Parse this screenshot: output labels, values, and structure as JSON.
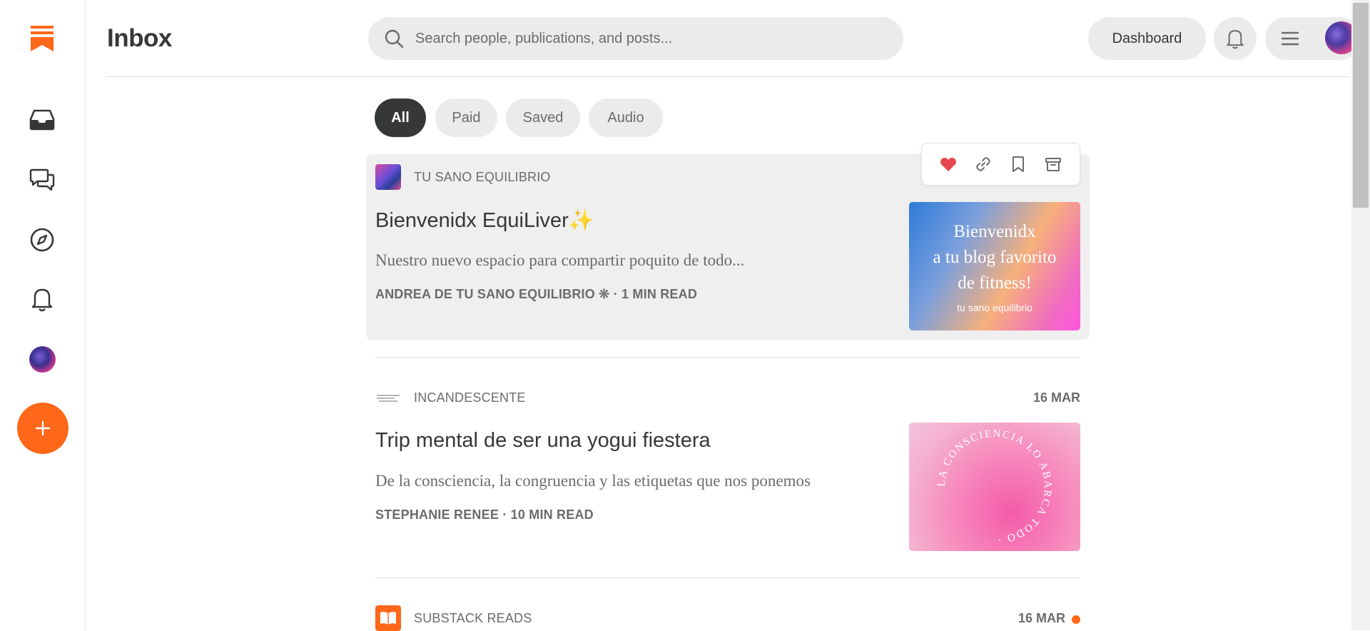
{
  "header": {
    "title": "Inbox",
    "search_placeholder": "Search people, publications, and posts...",
    "dashboard_label": "Dashboard"
  },
  "filters": [
    {
      "label": "All",
      "active": true
    },
    {
      "label": "Paid",
      "active": false
    },
    {
      "label": "Saved",
      "active": false
    },
    {
      "label": "Audio",
      "active": false
    }
  ],
  "posts": [
    {
      "publication": "TU SANO EQUILIBRIO",
      "title": "Bienvenidx EquiLiver✨",
      "subtitle": "Nuestro nuevo espacio para compartir poquito de todo...",
      "meta": "ANDREA DE TU SANO EQUILIBRIO ❊ · 1 MIN READ",
      "date": "",
      "image_text": [
        "Bienvenidx",
        "a tu blog favorito",
        "de fitness!"
      ],
      "image_brand": "tu sano equilibrio"
    },
    {
      "publication": "INCANDESCENTE",
      "title": "Trip mental de ser una yogui fiestera",
      "subtitle": "De la consciencia, la congruencia y las etiquetas que nos ponemos",
      "meta": "STEPHANIE RENEE · 10 MIN READ",
      "date": "16 MAR",
      "image_circle_text": "LA CONSCIENCIA LO ABARCA TODO · "
    },
    {
      "publication": "SUBSTACK READS",
      "date": "16 MAR",
      "unread": true
    }
  ],
  "colors": {
    "accent": "#ff6719",
    "pill_active": "#363737",
    "pill_bg": "#ebebeb",
    "heart": "#e5484d"
  }
}
